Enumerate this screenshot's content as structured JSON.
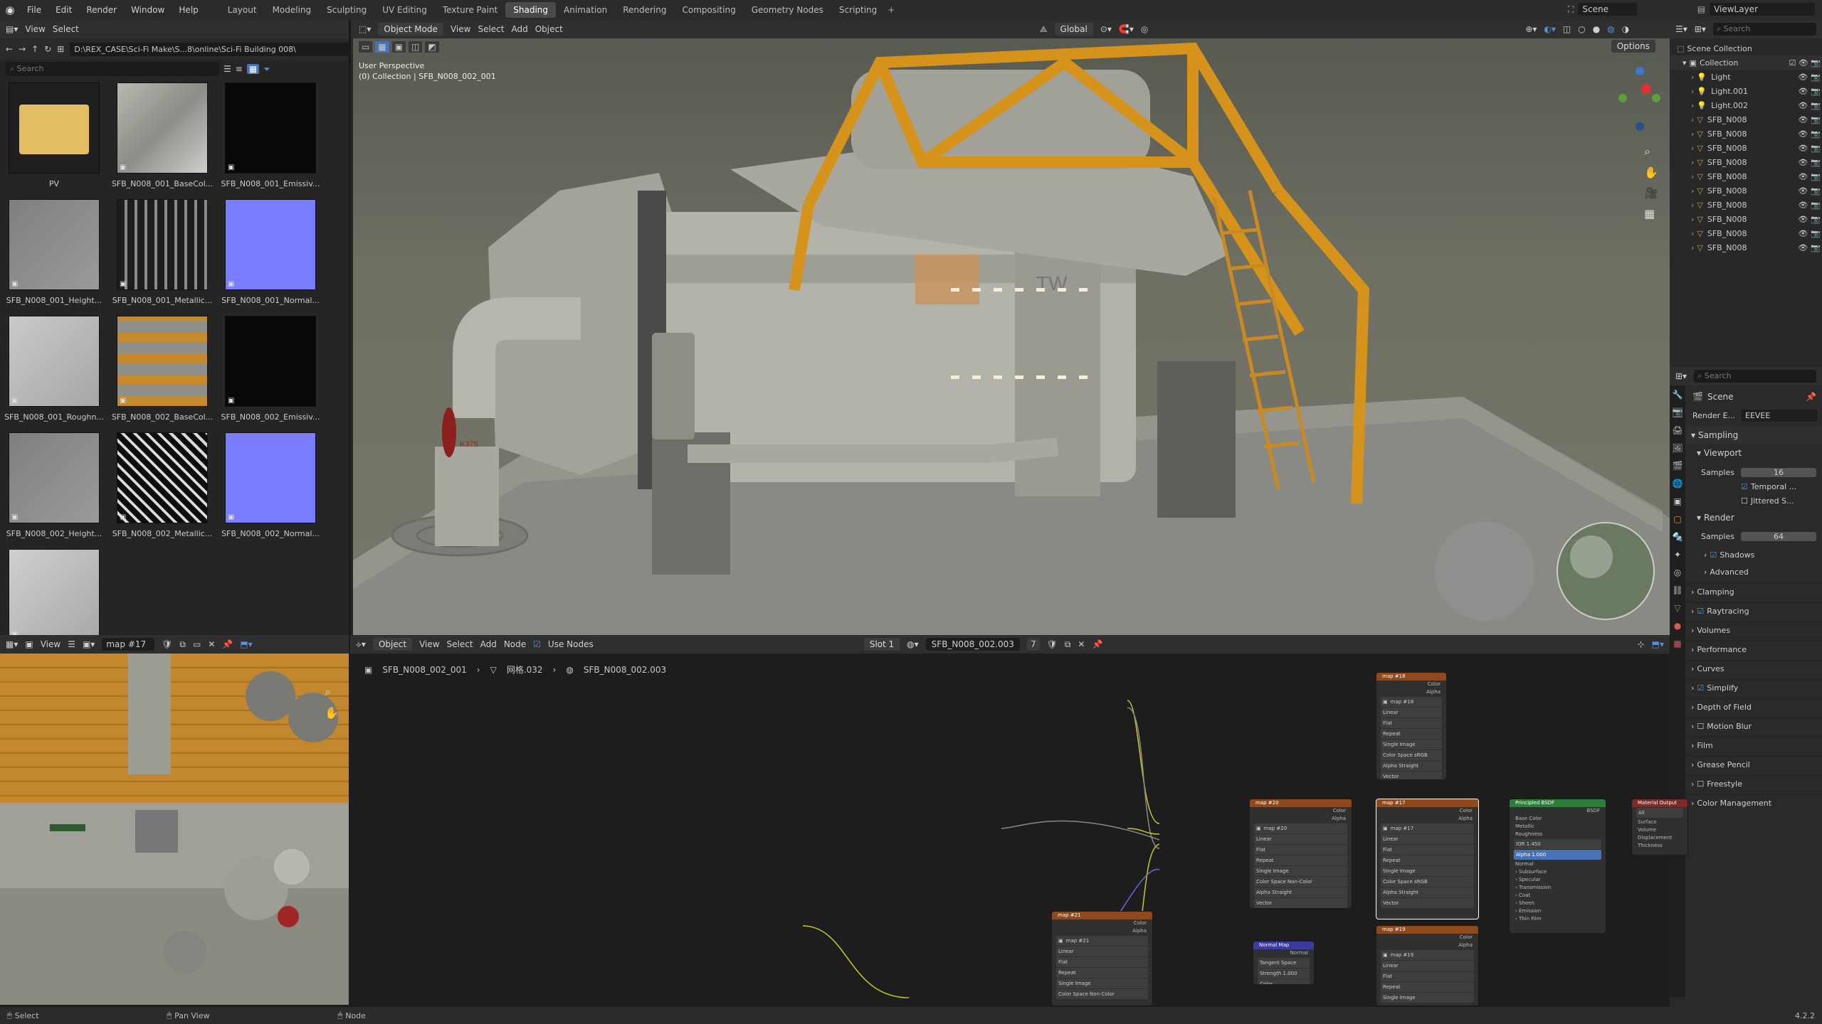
{
  "topbar": {
    "menus": [
      "File",
      "Edit",
      "Render",
      "Window",
      "Help"
    ],
    "workspaces": [
      "Layout",
      "Modeling",
      "Sculpting",
      "UV Editing",
      "Texture Paint",
      "Shading",
      "Animation",
      "Rendering",
      "Compositing",
      "Geometry Nodes",
      "Scripting"
    ],
    "active_workspace": "Shading",
    "scene": "Scene",
    "view_layer": "ViewLayer"
  },
  "file_browser": {
    "header_menus": [
      "View",
      "Select"
    ],
    "path": "D:\\REX_CASE\\Sci-Fi Make\\S...8\\online\\Sci-Fi Building 008\\",
    "search_placeholder": "Search",
    "items": [
      {
        "label": "PV",
        "kind": "folder"
      },
      {
        "label": "SFB_N008_001_BaseCol...",
        "kind": "basecolor"
      },
      {
        "label": "SFB_N008_001_Emissiv...",
        "kind": "emissive"
      },
      {
        "label": "SFB_N008_001_Height...",
        "kind": "height"
      },
      {
        "label": "SFB_N008_001_Metallic...",
        "kind": "metallic"
      },
      {
        "label": "SFB_N008_001_Normal...",
        "kind": "normal"
      },
      {
        "label": "SFB_N008_001_Roughn...",
        "kind": "rough"
      },
      {
        "label": "SFB_N008_002_BaseCol...",
        "kind": "basecolor2"
      },
      {
        "label": "SFB_N008_002_Emissiv...",
        "kind": "emissive"
      },
      {
        "label": "SFB_N008_002_Height...",
        "kind": "height"
      },
      {
        "label": "SFB_N008_002_Metallic...",
        "kind": "metallic2"
      },
      {
        "label": "SFB_N008_002_Normal...",
        "kind": "normal"
      },
      {
        "label": "",
        "kind": "rough2"
      }
    ]
  },
  "viewport": {
    "mode": "Object Mode",
    "menus": [
      "View",
      "Select",
      "Add",
      "Object"
    ],
    "orientation": "Global",
    "options": "Options",
    "perspective": "User Perspective",
    "collection_info": "(0) Collection | SFB_N008_002_001",
    "decal_text": "TW",
    "pipe_text": "K375"
  },
  "image_editor": {
    "menus": [
      "View",
      "View"
    ],
    "image_name": "map #17"
  },
  "node_editor": {
    "type": "Object",
    "menus": [
      "View",
      "Select",
      "Add",
      "Node"
    ],
    "use_nodes": "Use Nodes",
    "slot": "Slot 1",
    "material": "SFB_N008_002.003",
    "users": "7",
    "breadcrumb": [
      "SFB_N008_002_001",
      "网格.032",
      "SFB_N008_002.003"
    ],
    "nodes": {
      "map18": {
        "title": "map #18",
        "image": "map #18",
        "rows": [
          "Linear",
          "Flat",
          "Repeat",
          "Single Image",
          "Color Space   sRGB",
          "Alpha   Straight",
          "Vector"
        ],
        "outs": [
          "Color",
          "Alpha"
        ]
      },
      "map20": {
        "title": "map #20",
        "image": "map #20",
        "rows": [
          "Linear",
          "Flat",
          "Repeat",
          "Single Image",
          "Color Space   Non-Color",
          "Alpha   Straight",
          "Vector"
        ],
        "outs": [
          "Color",
          "Alpha"
        ]
      },
      "map17": {
        "title": "map #17",
        "image": "map #17",
        "rows": [
          "Linear",
          "Flat",
          "Repeat",
          "Single Image",
          "Color Space   sRGB",
          "Alpha   Straight",
          "Vector"
        ],
        "outs": [
          "Color",
          "Alpha"
        ]
      },
      "map21": {
        "title": "map #21",
        "image": "map #21",
        "rows": [
          "Linear",
          "Flat",
          "Repeat",
          "Single Image",
          "Color Space   Non-Color"
        ],
        "outs": [
          "Color",
          "Alpha"
        ]
      },
      "map19": {
        "title": "map #19",
        "image": "map #19",
        "rows": [
          "Linear",
          "Flat",
          "Repeat",
          "Single Image"
        ],
        "outs": [
          "Color",
          "Alpha"
        ]
      },
      "normal": {
        "title": "Normal Map",
        "rows": [
          "Tangent Space",
          "Strength   1.000",
          "Color"
        ],
        "outs": [
          "Normal"
        ]
      },
      "bsdf": {
        "title": "Principled BSDF",
        "out": "BSDF",
        "rows": [
          "Base Color",
          "Metallic",
          "Roughness",
          "IOR   1.450",
          "Alpha   1.000",
          "Normal",
          "› Subsurface",
          "› Specular",
          "› Transmission",
          "› Coat",
          "› Sheen",
          "› Emission",
          "› Thin Film"
        ]
      },
      "output": {
        "title": "Material Output",
        "target": "All",
        "rows": [
          "Surface",
          "Volume",
          "Displacement",
          "Thickness"
        ]
      }
    }
  },
  "outliner": {
    "search_placeholder": "Search",
    "root": "Scene Collection",
    "collection": "Collection",
    "items": [
      "Light",
      "Light.001",
      "Light.002",
      "SFB_N008",
      "SFB_N008",
      "SFB_N008",
      "SFB_N008",
      "SFB_N008",
      "SFB_N008",
      "SFB_N008",
      "SFB_N008",
      "SFB_N008",
      "SFB_N008"
    ]
  },
  "properties": {
    "search_placeholder": "Search",
    "scene": "Scene",
    "render_engine_label": "Render E...",
    "render_engine": "EEVEE",
    "sampling": "Sampling",
    "viewport": "Viewport",
    "samples_label": "Samples",
    "viewport_samples": "16",
    "temporal": "Temporal ...",
    "jittered": "Jittered S...",
    "render": "Render",
    "render_samples": "64",
    "shadows": "Shadows",
    "advanced": "Advanced",
    "sections": [
      "Clamping",
      "Raytracing",
      "Volumes",
      "Performance",
      "Curves",
      "Simplify",
      "Depth of Field",
      "Motion Blur",
      "Film",
      "Grease Pencil",
      "Freestyle",
      "Color Management"
    ]
  },
  "statusbar": {
    "select": "Select",
    "pan": "Pan View",
    "node": "Node",
    "version": "4.2.2"
  },
  "colors": {
    "accent": "#4772b3",
    "node_image_header": "#8e4a1f",
    "node_shader_header": "#2f7d3a",
    "node_output_header": "#7d2a2a",
    "node_vector_header": "#3a3aa0"
  }
}
